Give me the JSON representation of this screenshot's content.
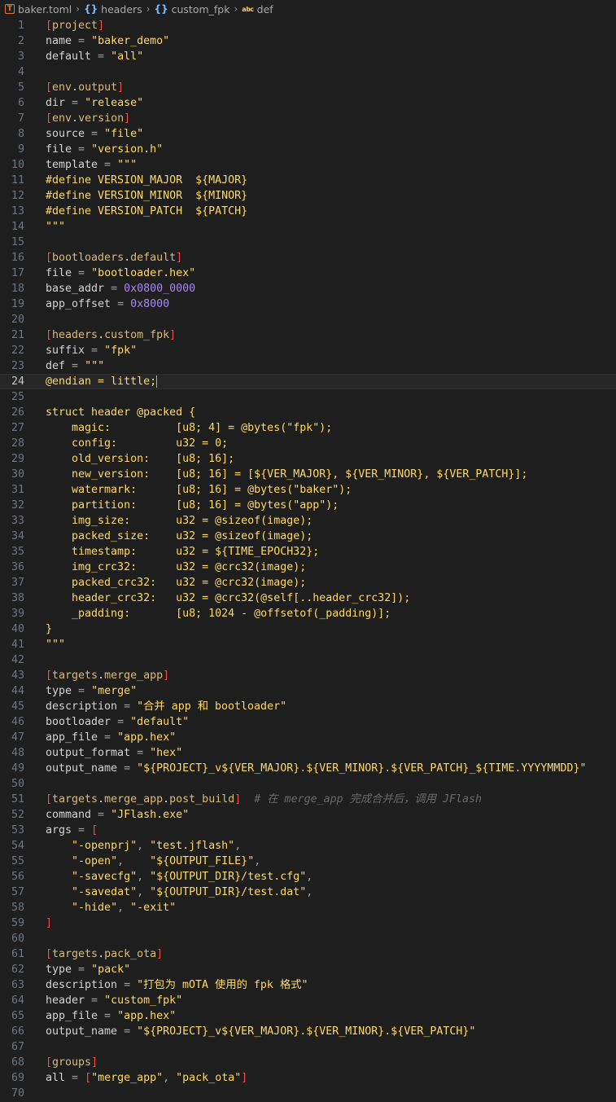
{
  "breadcrumb": [
    {
      "icon": "toml-file-icon",
      "label": "baker.toml"
    },
    {
      "icon": "braces-icon",
      "label": "headers"
    },
    {
      "icon": "braces-icon",
      "label": "custom_fpk"
    },
    {
      "icon": "string-abc-icon",
      "label": "def"
    }
  ],
  "current_line": 24,
  "lines": [
    [
      [
        "[",
        "b"
      ],
      [
        "project",
        "s"
      ],
      [
        "]",
        "b"
      ]
    ],
    [
      [
        "name",
        "k"
      ],
      [
        " = ",
        "p"
      ],
      [
        "\"baker_demo\"",
        "str"
      ]
    ],
    [
      [
        "default",
        "k"
      ],
      [
        " = ",
        "p"
      ],
      [
        "\"all\"",
        "str"
      ]
    ],
    [],
    [
      [
        "[",
        "b"
      ],
      [
        "env",
        "s"
      ],
      [
        ".",
        "d"
      ],
      [
        "output",
        "s"
      ],
      [
        "]",
        "b"
      ]
    ],
    [
      [
        "dir",
        "k"
      ],
      [
        " = ",
        "p"
      ],
      [
        "\"release\"",
        "str"
      ]
    ],
    [
      [
        "[",
        "b"
      ],
      [
        "env",
        "s"
      ],
      [
        ".",
        "d"
      ],
      [
        "version",
        "s"
      ],
      [
        "]",
        "b"
      ]
    ],
    [
      [
        "source",
        "k"
      ],
      [
        " = ",
        "p"
      ],
      [
        "\"file\"",
        "str"
      ]
    ],
    [
      [
        "file",
        "k"
      ],
      [
        " = ",
        "p"
      ],
      [
        "\"version.h\"",
        "str"
      ]
    ],
    [
      [
        "template",
        "k"
      ],
      [
        " = ",
        "p"
      ],
      [
        "\"\"\"",
        "str"
      ]
    ],
    [
      [
        "#define VERSION_MAJOR  ${MAJOR}",
        "str"
      ]
    ],
    [
      [
        "#define VERSION_MINOR  ${MINOR}",
        "str"
      ]
    ],
    [
      [
        "#define VERSION_PATCH  ${PATCH}",
        "str"
      ]
    ],
    [
      [
        "\"\"\"",
        "str"
      ]
    ],
    [],
    [
      [
        "[",
        "b"
      ],
      [
        "bootloaders",
        "s"
      ],
      [
        ".",
        "d"
      ],
      [
        "default",
        "s"
      ],
      [
        "]",
        "b"
      ]
    ],
    [
      [
        "file",
        "k"
      ],
      [
        " = ",
        "p"
      ],
      [
        "\"bootloader.hex\"",
        "str"
      ]
    ],
    [
      [
        "base_addr",
        "k"
      ],
      [
        " = ",
        "p"
      ],
      [
        "0x0800_0000",
        "n"
      ]
    ],
    [
      [
        "app_offset",
        "k"
      ],
      [
        " = ",
        "p"
      ],
      [
        "0x8000",
        "n"
      ]
    ],
    [],
    [
      [
        "[",
        "b"
      ],
      [
        "headers",
        "s"
      ],
      [
        ".",
        "d"
      ],
      [
        "custom_fpk",
        "s"
      ],
      [
        "]",
        "b"
      ]
    ],
    [
      [
        "suffix",
        "k"
      ],
      [
        " = ",
        "p"
      ],
      [
        "\"fpk\"",
        "str"
      ]
    ],
    [
      [
        "def",
        "k"
      ],
      [
        " = ",
        "p"
      ],
      [
        "\"\"\"",
        "str"
      ]
    ],
    [
      [
        "@endian = little;",
        "str"
      ]
    ],
    [],
    [
      [
        "struct header @packed {",
        "str"
      ]
    ],
    [
      [
        "    magic:          [u8; 4] = @bytes(\"fpk\");",
        "str"
      ]
    ],
    [
      [
        "    config:         u32 = 0;",
        "str"
      ]
    ],
    [
      [
        "    old_version:    [u8; 16];",
        "str"
      ]
    ],
    [
      [
        "    new_version:    [u8; 16] = [${VER_MAJOR}, ${VER_MINOR}, ${VER_PATCH}];",
        "str"
      ]
    ],
    [
      [
        "    watermark:      [u8; 16] = @bytes(\"baker\");",
        "str"
      ]
    ],
    [
      [
        "    partition:      [u8; 16] = @bytes(\"app\");",
        "str"
      ]
    ],
    [
      [
        "    img_size:       u32 = @sizeof(image);",
        "str"
      ]
    ],
    [
      [
        "    packed_size:    u32 = @sizeof(image);",
        "str"
      ]
    ],
    [
      [
        "    timestamp:      u32 = ${TIME_EPOCH32};",
        "str"
      ]
    ],
    [
      [
        "    img_crc32:      u32 = @crc32(image);",
        "str"
      ]
    ],
    [
      [
        "    packed_crc32:   u32 = @crc32(image);",
        "str"
      ]
    ],
    [
      [
        "    header_crc32:   u32 = @crc32(@self[..header_crc32]);",
        "str"
      ]
    ],
    [
      [
        "    _padding:       [u8; 1024 - @offsetof(_padding)];",
        "str"
      ]
    ],
    [
      [
        "}",
        "str"
      ]
    ],
    [
      [
        "\"\"\"",
        "str"
      ]
    ],
    [],
    [
      [
        "[",
        "b"
      ],
      [
        "targets",
        "s"
      ],
      [
        ".",
        "d"
      ],
      [
        "merge_app",
        "s"
      ],
      [
        "]",
        "b"
      ]
    ],
    [
      [
        "type",
        "k"
      ],
      [
        " = ",
        "p"
      ],
      [
        "\"merge\"",
        "str"
      ]
    ],
    [
      [
        "description",
        "k"
      ],
      [
        " = ",
        "p"
      ],
      [
        "\"合并 app 和 bootloader\"",
        "str"
      ]
    ],
    [
      [
        "bootloader",
        "k"
      ],
      [
        " = ",
        "p"
      ],
      [
        "\"default\"",
        "str"
      ]
    ],
    [
      [
        "app_file",
        "k"
      ],
      [
        " = ",
        "p"
      ],
      [
        "\"app.hex\"",
        "str"
      ]
    ],
    [
      [
        "output_format",
        "k"
      ],
      [
        " = ",
        "p"
      ],
      [
        "\"hex\"",
        "str"
      ]
    ],
    [
      [
        "output_name",
        "k"
      ],
      [
        " = ",
        "p"
      ],
      [
        "\"${PROJECT}_v${VER_MAJOR}.${VER_MINOR}.${VER_PATCH}_${TIME.YYYYMMDD}\"",
        "str"
      ]
    ],
    [],
    [
      [
        "[",
        "b"
      ],
      [
        "targets",
        "s"
      ],
      [
        ".",
        "d"
      ],
      [
        "merge_app",
        "s"
      ],
      [
        ".",
        "d"
      ],
      [
        "post_build",
        "s"
      ],
      [
        "]",
        "b"
      ],
      [
        "  # 在 merge_app 完成合并后，调用 JFlash",
        "c"
      ]
    ],
    [
      [
        "command",
        "k"
      ],
      [
        " = ",
        "p"
      ],
      [
        "\"JFlash.exe\"",
        "str"
      ]
    ],
    [
      [
        "args",
        "k"
      ],
      [
        " = ",
        "p"
      ],
      [
        "[",
        "b"
      ]
    ],
    [
      [
        "    ",
        "k"
      ],
      [
        "\"-openprj\"",
        "str"
      ],
      [
        ", ",
        "p"
      ],
      [
        "\"test.jflash\"",
        "str"
      ],
      [
        ",",
        "p"
      ]
    ],
    [
      [
        "    ",
        "k"
      ],
      [
        "\"-open\"",
        "str"
      ],
      [
        ",    ",
        "p"
      ],
      [
        "\"${OUTPUT_FILE}\"",
        "str"
      ],
      [
        ",",
        "p"
      ]
    ],
    [
      [
        "    ",
        "k"
      ],
      [
        "\"-savecfg\"",
        "str"
      ],
      [
        ", ",
        "p"
      ],
      [
        "\"${OUTPUT_DIR}/test.cfg\"",
        "str"
      ],
      [
        ",",
        "p"
      ]
    ],
    [
      [
        "    ",
        "k"
      ],
      [
        "\"-savedat\"",
        "str"
      ],
      [
        ", ",
        "p"
      ],
      [
        "\"${OUTPUT_DIR}/test.dat\"",
        "str"
      ],
      [
        ",",
        "p"
      ]
    ],
    [
      [
        "    ",
        "k"
      ],
      [
        "\"-hide\"",
        "str"
      ],
      [
        ", ",
        "p"
      ],
      [
        "\"-exit\"",
        "str"
      ]
    ],
    [
      [
        "]",
        "b"
      ]
    ],
    [],
    [
      [
        "[",
        "b"
      ],
      [
        "targets",
        "s"
      ],
      [
        ".",
        "d"
      ],
      [
        "pack_ota",
        "s"
      ],
      [
        "]",
        "b"
      ]
    ],
    [
      [
        "type",
        "k"
      ],
      [
        " = ",
        "p"
      ],
      [
        "\"pack\"",
        "str"
      ]
    ],
    [
      [
        "description",
        "k"
      ],
      [
        " = ",
        "p"
      ],
      [
        "\"打包为 mOTA 使用的 fpk 格式\"",
        "str"
      ]
    ],
    [
      [
        "header",
        "k"
      ],
      [
        " = ",
        "p"
      ],
      [
        "\"custom_fpk\"",
        "str"
      ]
    ],
    [
      [
        "app_file",
        "k"
      ],
      [
        " = ",
        "p"
      ],
      [
        "\"app.hex\"",
        "str"
      ]
    ],
    [
      [
        "output_name",
        "k"
      ],
      [
        " = ",
        "p"
      ],
      [
        "\"${PROJECT}_v${VER_MAJOR}.${VER_MINOR}.${VER_PATCH}\"",
        "str"
      ]
    ],
    [],
    [
      [
        "[",
        "b"
      ],
      [
        "groups",
        "s"
      ],
      [
        "]",
        "b"
      ]
    ],
    [
      [
        "all",
        "k"
      ],
      [
        " = ",
        "p"
      ],
      [
        "[",
        "b"
      ],
      [
        "\"merge_app\"",
        "str"
      ],
      [
        ", ",
        "p"
      ],
      [
        "\"pack_ota\"",
        "str"
      ],
      [
        "]",
        "b"
      ]
    ],
    []
  ]
}
